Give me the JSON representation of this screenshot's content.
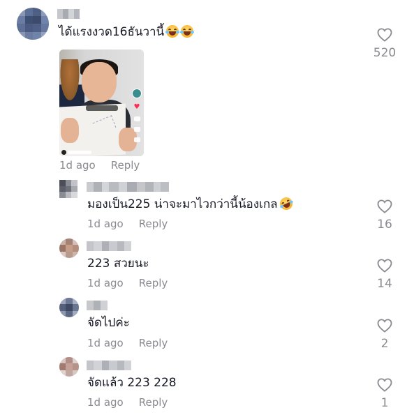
{
  "comments": [
    {
      "text": "ได้แรงงวด16ธันวานี้",
      "emojis": [
        "laughing-emoji",
        "laughing-emoji"
      ],
      "time": "1d ago",
      "reply_label": "Reply",
      "likes": "520",
      "has_video_thumbnail": true
    },
    {
      "text": "มองเป็น225 น่าจะมาไวกว่านี้น้องเกล",
      "emojis": [
        "rofl-emoji"
      ],
      "time": "1d ago",
      "reply_label": "Reply",
      "likes": "16"
    },
    {
      "text": "223 สวยนะ",
      "time": "1d ago",
      "reply_label": "Reply",
      "likes": "14"
    },
    {
      "text": "จัดไปค่ะ",
      "time": "1d ago",
      "reply_label": "Reply",
      "likes": "2"
    },
    {
      "text": "จัดแล้ว 223 228",
      "time": "1d ago",
      "reply_label": "Reply",
      "likes": "1"
    }
  ],
  "colors": {
    "text": "#161823",
    "meta": "#8a8b91",
    "heart_outline": "#8a8b91"
  }
}
